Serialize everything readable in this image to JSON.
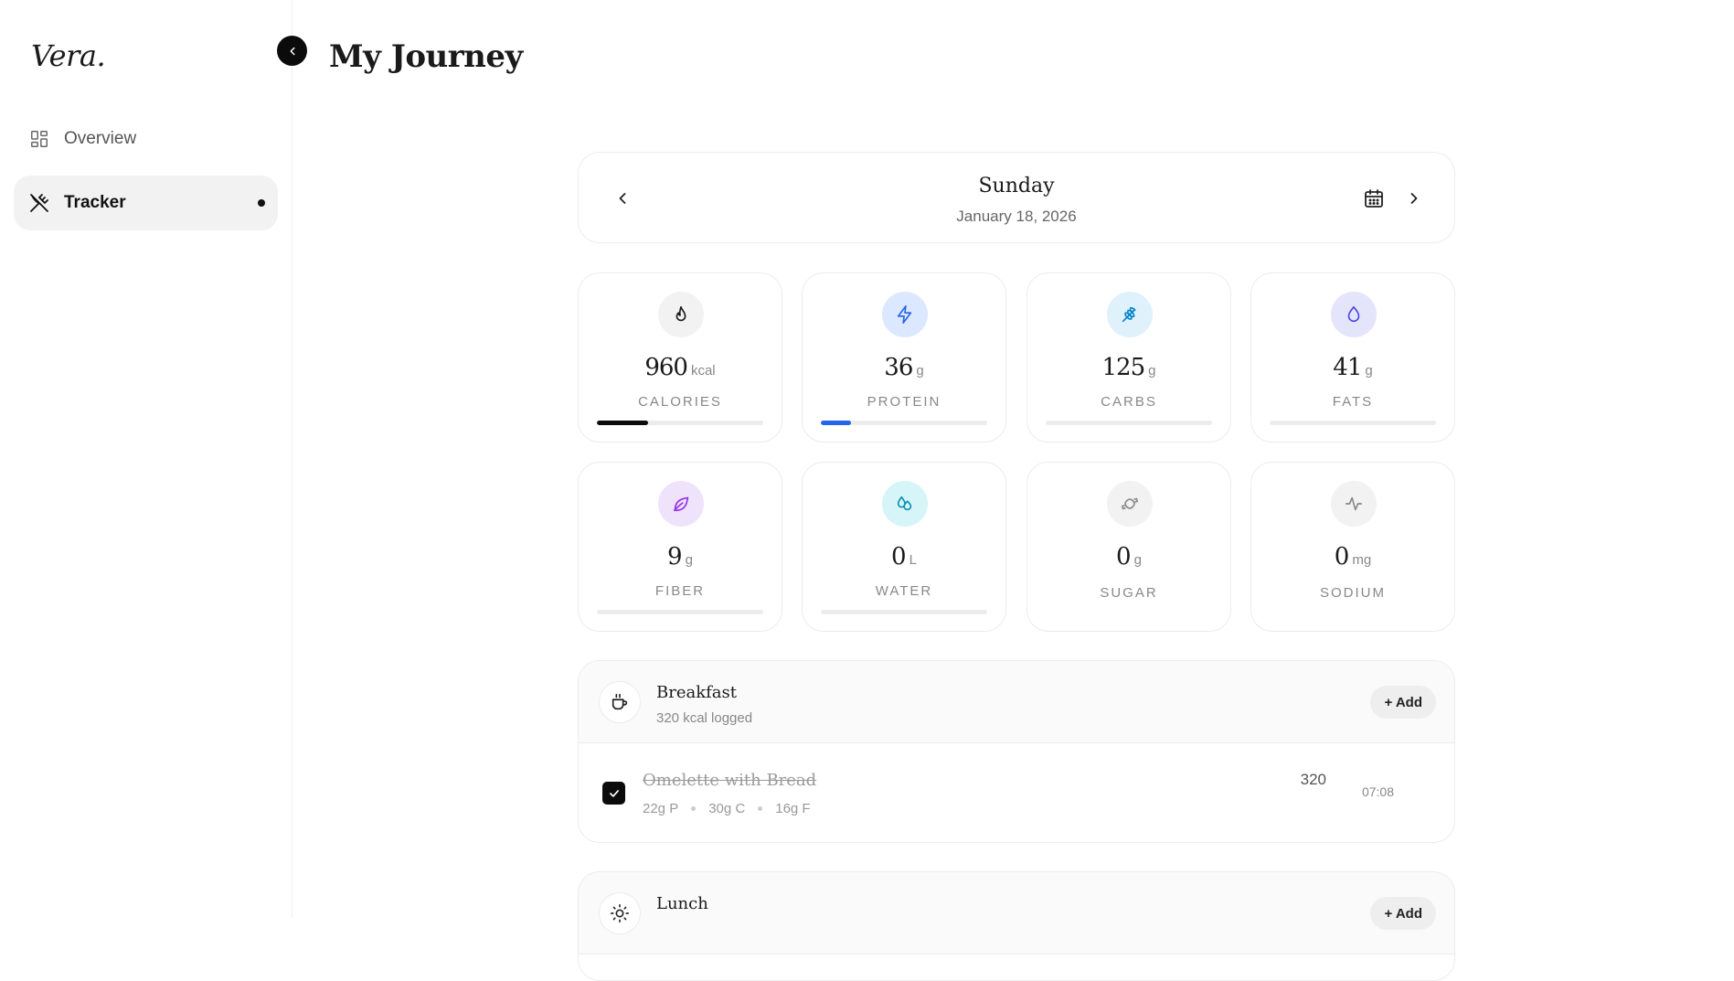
{
  "app": {
    "logo": "Vera."
  },
  "sidebar": {
    "items": [
      {
        "label": "Overview",
        "icon": "grid-icon",
        "active": false
      },
      {
        "label": "Tracker",
        "icon": "utensils-crossed-icon",
        "active": true
      }
    ]
  },
  "page": {
    "title": "My Journey"
  },
  "date_nav": {
    "day": "Sunday",
    "date": "January 18, 2026"
  },
  "stats": [
    {
      "value": "960",
      "unit": "kcal",
      "label": "CALORIES",
      "icon": "flame-icon",
      "progress": 0.31,
      "bar_color": "#0b0b0b",
      "icon_bg": "#f2f2f2",
      "icon_color": "#1a1a1a"
    },
    {
      "value": "36",
      "unit": "g",
      "label": "PROTEIN",
      "icon": "bolt-icon",
      "progress": 0.18,
      "bar_color": "#2563eb",
      "icon_bg": "#dbe8ff",
      "icon_color": "#2563eb"
    },
    {
      "value": "125",
      "unit": "g",
      "label": "CARBS",
      "icon": "wheat-icon",
      "progress": 0,
      "bar_color": "#0ea5e9",
      "icon_bg": "#dff1fb",
      "icon_color": "#0284c7"
    },
    {
      "value": "41",
      "unit": "g",
      "label": "FATS",
      "icon": "droplet-icon",
      "progress": 0,
      "bar_color": "#6366f1",
      "icon_bg": "#e4e5fb",
      "icon_color": "#4f46e5"
    },
    {
      "value": "9",
      "unit": "g",
      "label": "FIBER",
      "icon": "leaf-icon",
      "progress": 0,
      "bar_color": "#9333ea",
      "icon_bg": "#efe2fb",
      "icon_color": "#9333ea"
    },
    {
      "value": "0",
      "unit": "L",
      "label": "WATER",
      "icon": "droplets-icon",
      "progress": 0,
      "bar_color": "#06b6d4",
      "icon_bg": "#d6f5f8",
      "icon_color": "#0891b2"
    },
    {
      "value": "0",
      "unit": "g",
      "label": "SUGAR",
      "icon": "candy-icon",
      "icon_bg": "#f2f2f2",
      "icon_color": "#888888"
    },
    {
      "value": "0",
      "unit": "mg",
      "label": "SODIUM",
      "icon": "activity-icon",
      "icon_bg": "#f2f2f2",
      "icon_color": "#888888"
    }
  ],
  "meals": [
    {
      "name": "Breakfast",
      "logged": "320 kcal logged",
      "add_label": "+ Add",
      "icon": "coffee-icon",
      "foods": [
        {
          "name": "Omelette with Bread",
          "protein": "22g P",
          "carbs": "30g C",
          "fat": "16g F",
          "kcal": "320",
          "time": "07:08",
          "checked": true
        }
      ]
    },
    {
      "name": "Lunch",
      "add_label": "+ Add",
      "icon": "sun-icon"
    }
  ]
}
